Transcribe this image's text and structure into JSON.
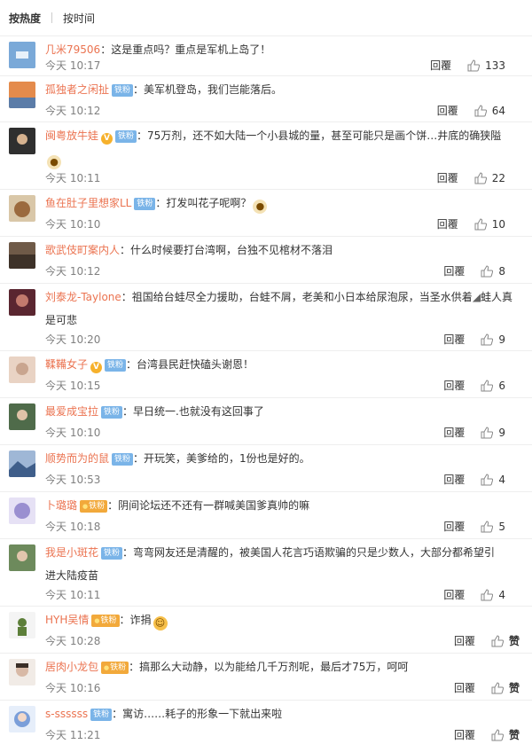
{
  "sort": {
    "hot": "按热度",
    "time": "按时间"
  },
  "reply_label": "回覆",
  "badge_iron": "铁粉",
  "badge_gold": "铁粉",
  "comments": [
    {
      "user": "几米79506",
      "text": "：这是重点吗？重点是军机上岛了！",
      "time": "今天 10:17",
      "likes": "133",
      "avatar_color": "#7aa9d8"
    },
    {
      "user": "孤独者之闲扯",
      "text": "：美军机登岛，我们岂能落后。",
      "time": "今天 10:12",
      "likes": "64",
      "avatar_color": "#e48b4c"
    },
    {
      "user": "闽粤放牛娃",
      "text": "：75万剂，还不如大陆一个小县城的量，甚至可能只是画个饼…井底的确狭隘",
      "time": "今天 10:11",
      "likes": "22",
      "avatar_color": "#3a3a3a"
    },
    {
      "user": "鱼在肚子里想家LL",
      "text": "：打发叫花子呢啊？",
      "time": "今天 10:10",
      "likes": "10",
      "avatar_color": "#b58a5c"
    },
    {
      "user": "歌武伎町案内人",
      "text": "：什么时候要打台湾啊，台独不见棺材不落泪",
      "time": "今天 10:12",
      "likes": "8",
      "avatar_color": "#6f5a48"
    },
    {
      "user": "刘泰龙-Taylone",
      "text": "：祖国给台蛙尽全力援助，台蛙不屑，老美和小日本给尿泡尿，当圣水供着",
      "text2": "蛙人真是可悲",
      "time": "今天 10:20",
      "likes": "9",
      "avatar_color": "#5a2630"
    },
    {
      "user": "鞣鞴女子",
      "text": "：台湾县民赶快磕头谢恩！",
      "time": "今天 10:15",
      "likes": "6",
      "avatar_color": "#c9a58f"
    },
    {
      "user": "最爱成宝拉",
      "text": "：早日统一.也就没有这回事了",
      "time": "今天 10:10",
      "likes": "9",
      "avatar_color": "#4f6b4a"
    },
    {
      "user": "顺势而为的鼠",
      "text": "：开玩笑，美爹给的，1份也是好的。",
      "time": "今天 10:53",
      "likes": "4",
      "avatar_color": "#3f5e8a"
    },
    {
      "user": "卜璐璐",
      "text": "：阴间论坛还不还有一群喊美国爹真帅的嘛",
      "time": "今天 10:18",
      "likes": "5",
      "avatar_color": "#9a8fd0"
    },
    {
      "user": "我是小斑花",
      "text": "：弯弯网友还是清醒的，被美国人花言巧语欺骗的只是少数人，大部分都希望引",
      "text2": "进大陆疫苗",
      "time": "今天 10:11",
      "likes": "4",
      "avatar_color": "#6d8a5c"
    },
    {
      "user": "HYH吴情",
      "text": "：诈捐",
      "time": "今天 10:28",
      "likes": "赞",
      "avatar_color": "#5d7f3a"
    },
    {
      "user": "居肉小龙包",
      "text": "：搞那么大动静，以为能给几千万剂呢，最后才75万，呵呵",
      "time": "今天 10:16",
      "likes": "赞",
      "avatar_color": "#d8b9a6"
    },
    {
      "user": "s-ssssss",
      "text": "：寓访……耗子的形象一下就出来啦",
      "time": "今天 11:21",
      "likes": "赞",
      "avatar_color": "#7a9ed9"
    }
  ]
}
